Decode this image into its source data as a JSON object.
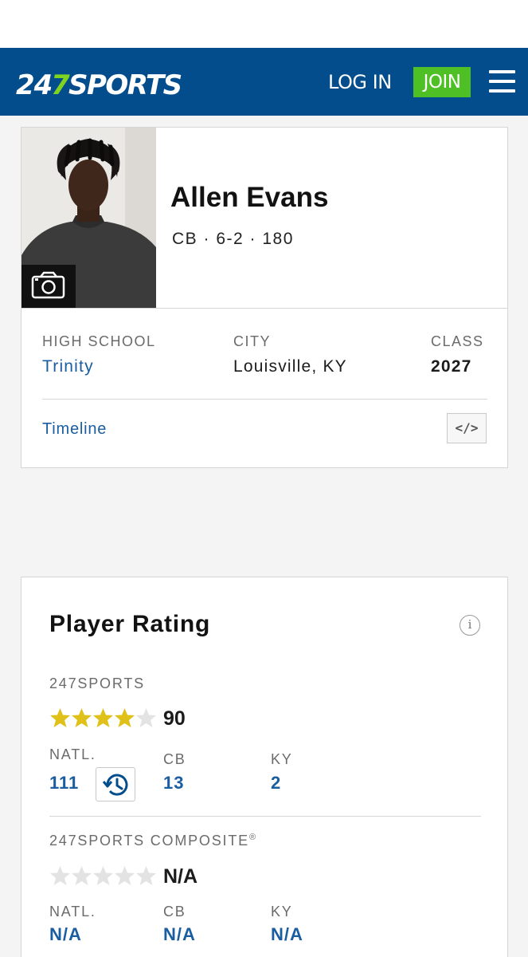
{
  "header": {
    "logo_text": "247SPORTS",
    "login_label": "LOG IN",
    "join_label": "JOIN",
    "brand_color": "#044d8c",
    "join_color": "#4fbf26",
    "logo_green": "#7ed321"
  },
  "profile": {
    "name": "Allen Evans",
    "position": "CB",
    "height": "6-2",
    "weight": "180",
    "meta_line": "CB · 6-2 · 180",
    "high_school_label": "HIGH SCHOOL",
    "high_school": "Trinity",
    "city_label": "CITY",
    "city": "Louisville, KY",
    "class_label": "CLASS",
    "class_year": "2027",
    "timeline_label": "Timeline",
    "embed_label": "</>"
  },
  "rating": {
    "title": "Player Rating",
    "info_label": "i",
    "sports247": {
      "label": "247SPORTS",
      "stars_filled": 4,
      "stars_total": 5,
      "score": "90",
      "natl_label": "NATL.",
      "natl": "111",
      "pos_label": "CB",
      "pos_rank": "13",
      "state_label": "KY",
      "state_rank": "2"
    },
    "composite": {
      "label": "247SPORTS COMPOSITE",
      "label_mark": "®",
      "stars_filled": 0,
      "stars_total": 5,
      "score": "N/A",
      "natl_label": "NATL.",
      "natl": "N/A",
      "pos_label": "CB",
      "pos_rank": "N/A",
      "state_label": "KY",
      "state_rank": "N/A"
    },
    "star_color": "#e0c11a",
    "star_empty_color": "#e3e3e3"
  }
}
